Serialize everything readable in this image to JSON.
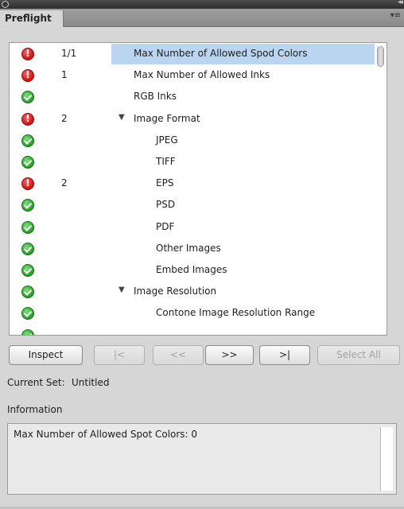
{
  "panel": {
    "tab_label": "Preflight",
    "panel_menu_glyph": "▾≡",
    "collapse_glyph": "◂◂"
  },
  "rows": [
    {
      "status": "error",
      "count": "1/1",
      "label": "Max Number of Allowed Spod Colors",
      "indent": 0,
      "expander": "",
      "selected": true
    },
    {
      "status": "error",
      "count": "1",
      "label": "Max Number of Allowed Inks",
      "indent": 0,
      "expander": "",
      "selected": false
    },
    {
      "status": "ok",
      "count": "",
      "label": "RGB Inks",
      "indent": 0,
      "expander": "",
      "selected": false
    },
    {
      "status": "error",
      "count": "2",
      "label": "Image Format",
      "indent": 0,
      "expander": "▼",
      "selected": false
    },
    {
      "status": "ok",
      "count": "",
      "label": "JPEG",
      "indent": 1,
      "expander": "",
      "selected": false
    },
    {
      "status": "ok",
      "count": "",
      "label": "TIFF",
      "indent": 1,
      "expander": "",
      "selected": false
    },
    {
      "status": "error",
      "count": "2",
      "label": "EPS",
      "indent": 1,
      "expander": "",
      "selected": false
    },
    {
      "status": "ok",
      "count": "",
      "label": "PSD",
      "indent": 1,
      "expander": "",
      "selected": false
    },
    {
      "status": "ok",
      "count": "",
      "label": "PDF",
      "indent": 1,
      "expander": "",
      "selected": false
    },
    {
      "status": "ok",
      "count": "",
      "label": "Other Images",
      "indent": 1,
      "expander": "",
      "selected": false
    },
    {
      "status": "ok",
      "count": "",
      "label": "Embed Images",
      "indent": 1,
      "expander": "",
      "selected": false
    },
    {
      "status": "ok",
      "count": "",
      "label": "Image Resolution",
      "indent": 0,
      "expander": "▼",
      "selected": false
    },
    {
      "status": "ok",
      "count": "",
      "label": "Contone Image Resolution Range",
      "indent": 1,
      "expander": "",
      "selected": false
    },
    {
      "status": "ok",
      "count": "",
      "label": "",
      "indent": 1,
      "expander": "",
      "selected": false
    }
  ],
  "buttons": {
    "inspect": "Inspect",
    "first": "|<",
    "prev": "<<",
    "next": ">>",
    "last": ">|",
    "select_all": "Select All"
  },
  "current_set": {
    "label": "Current Set:",
    "value": "Untitled"
  },
  "information": {
    "label": "Information",
    "text": "Max Number of Allowed Spot Colors: 0"
  }
}
